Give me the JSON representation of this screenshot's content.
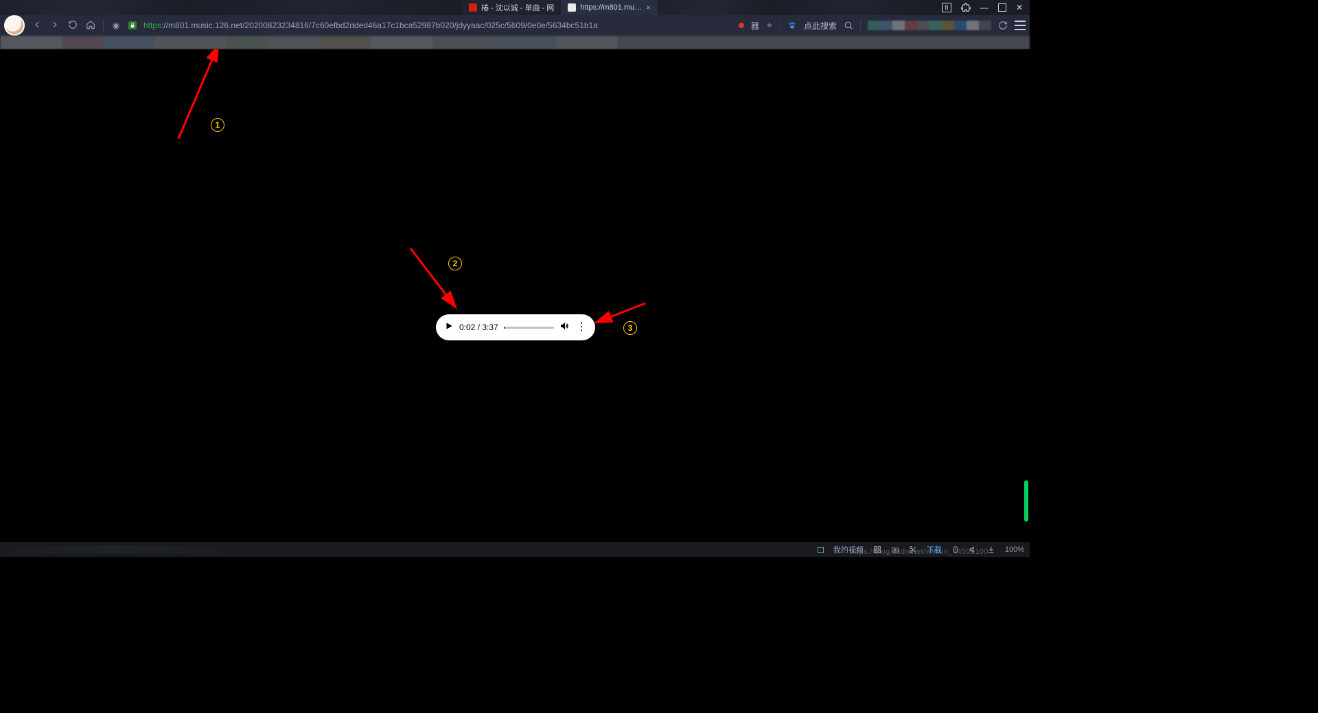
{
  "titlebar": {
    "tabs": [
      {
        "label": "椿 - 沈以诚 - 单曲 - 网",
        "favicon": "#d81e06",
        "active": false
      },
      {
        "label": "https://m801.mu…",
        "favicon": "#e8eaed",
        "active": true
      }
    ],
    "badge": "8",
    "min": "—",
    "max": "▢",
    "close": "✕"
  },
  "toolbar": {
    "url_scheme": "https",
    "url_rest": "://m801.music.126.net/20200823234816/7c60efbd2dded46a17c1bca52987b020/jdyyaac/025c/5609/0e0e/5634bc51b1a",
    "search_link": "点此搜索",
    "ext_glyph_1": "器",
    "ext_glyph_2": "✧"
  },
  "annotations": {
    "a": "1",
    "b": "2",
    "c": "3"
  },
  "player": {
    "time_current": "0:02",
    "time_total": "3:37"
  },
  "statusbar": {
    "video": "我的视频",
    "download": "下载",
    "zoom": "100%",
    "watermark": "https://blog.csdn.net/weixin_44505100"
  },
  "colors": {
    "arrow": "#ff0000",
    "badge": "#ffcc00"
  },
  "chart_data": null
}
